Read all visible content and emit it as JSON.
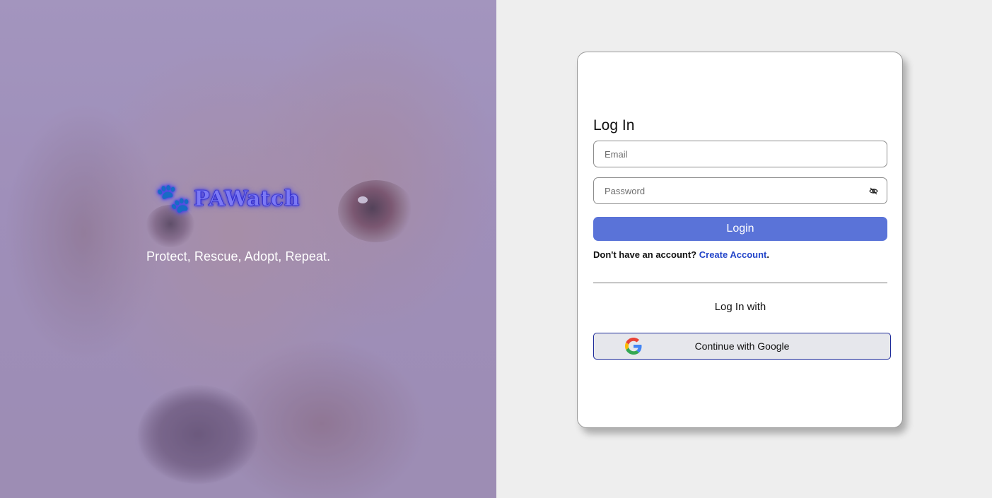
{
  "brand": {
    "name": "PAWatch",
    "tagline": "Protect, Rescue, Adopt, Repeat.",
    "logo_icon": "paw-icon",
    "accent_color": "#5a73d8"
  },
  "login": {
    "heading": "Log In",
    "email_placeholder": "Email",
    "password_placeholder": "Password",
    "password_toggle_icon": "eye-slash-icon",
    "submit_label": "Login",
    "signup_prompt": "Don't have an account?",
    "signup_link": "Create Account",
    "signup_suffix": ".",
    "alt_heading": "Log In with",
    "google_label": "Continue with Google",
    "google_icon": "google-icon"
  }
}
